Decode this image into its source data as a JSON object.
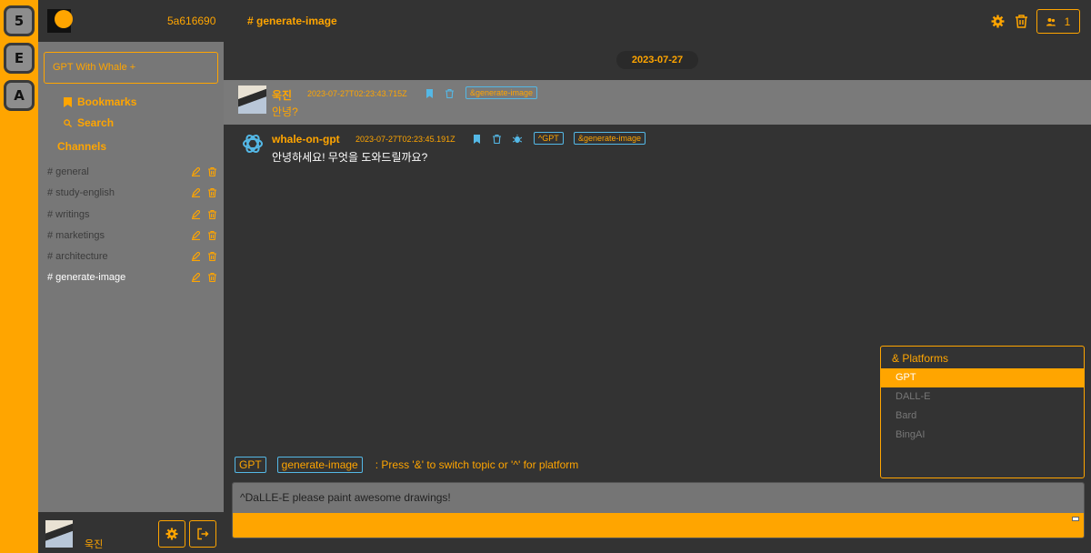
{
  "rail": {
    "items": [
      "5",
      "E",
      "A"
    ]
  },
  "sidebar": {
    "team_id": "5a616690",
    "gpt_button": "GPT With Whale +",
    "bookmarks": "Bookmarks",
    "search": "Search",
    "channels_title": "Channels",
    "channels": [
      {
        "name": "# general"
      },
      {
        "name": "# study-english"
      },
      {
        "name": "# writings"
      },
      {
        "name": "# marketings"
      },
      {
        "name": "# architecture"
      },
      {
        "name": "# generate-image"
      }
    ],
    "active_channel": "# generate-image",
    "footer": {
      "username": "욱진"
    }
  },
  "header": {
    "channel_title": "# generate-image",
    "member_count": "1"
  },
  "date_divider": "2023-07-27",
  "messages": [
    {
      "user": "욱진",
      "time": "2023-07-27T02:23:43.715Z",
      "text": "안녕?",
      "tags": [
        "&generate-image"
      ]
    },
    {
      "user": "whale-on-gpt",
      "time": "2023-07-27T02:23:45.191Z",
      "text": "안녕하세요! 무엇을 도와드릴까요?",
      "tags": [
        "^GPT",
        "&generate-image"
      ]
    }
  ],
  "platforms": {
    "title": "& Platforms",
    "items": [
      "GPT",
      "DALL-E",
      "Bard",
      "BingAI"
    ],
    "selected": "GPT"
  },
  "hint": {
    "platform_tag": "GPT",
    "topic_tag": "generate-image",
    "text": ": Press '&' to switch topic or '^' for platform"
  },
  "composer": {
    "value": "^DaLLE-E please paint awesome drawings!"
  },
  "colors": {
    "accent": "#ffa500",
    "tag_blue": "#54b8e6",
    "bg_dark": "#333333",
    "bg_mid": "#777777"
  },
  "icons": [
    "bookmark-icon",
    "search-icon",
    "edit-icon",
    "trash-icon",
    "gear-icon",
    "logout-icon",
    "members-icon",
    "openai-icon",
    "bug-icon"
  ]
}
